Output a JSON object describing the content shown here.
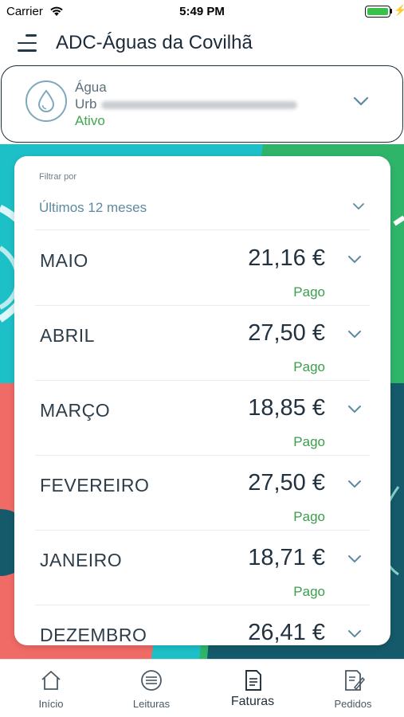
{
  "status_bar": {
    "carrier": "Carrier",
    "time": "5:49 PM"
  },
  "header": {
    "title": "ADC-Águas da Covilhã"
  },
  "contract": {
    "type": "Água",
    "address_prefix": "Urb",
    "status": "Ativo"
  },
  "filter": {
    "label": "Filtrar por",
    "value": "Últimos 12 meses"
  },
  "bills": [
    {
      "month": "MAIO",
      "amount": "21,16 €",
      "status": "Pago"
    },
    {
      "month": "ABRIL",
      "amount": "27,50 €",
      "status": "Pago"
    },
    {
      "month": "MARÇO",
      "amount": "18,85 €",
      "status": "Pago"
    },
    {
      "month": "FEVEREIRO",
      "amount": "27,50 €",
      "status": "Pago"
    },
    {
      "month": "JANEIRO",
      "amount": "18,71 €",
      "status": "Pago"
    },
    {
      "month": "DEZEMBRO",
      "amount": "26,41 €",
      "status": ""
    }
  ],
  "tabs": [
    {
      "label": "Início",
      "icon": "home-icon"
    },
    {
      "label": "Leituras",
      "icon": "meter-icon"
    },
    {
      "label": "Faturas",
      "icon": "invoice-icon",
      "active": true
    },
    {
      "label": "Pedidos",
      "icon": "request-icon"
    }
  ],
  "colors": {
    "accent": "#5d8aa0",
    "paid_green": "#3a9e4c",
    "background_teal": "#1ec0c8",
    "background_green": "#2fb56a",
    "background_coral": "#f06a66",
    "background_dark": "#155a6b"
  }
}
